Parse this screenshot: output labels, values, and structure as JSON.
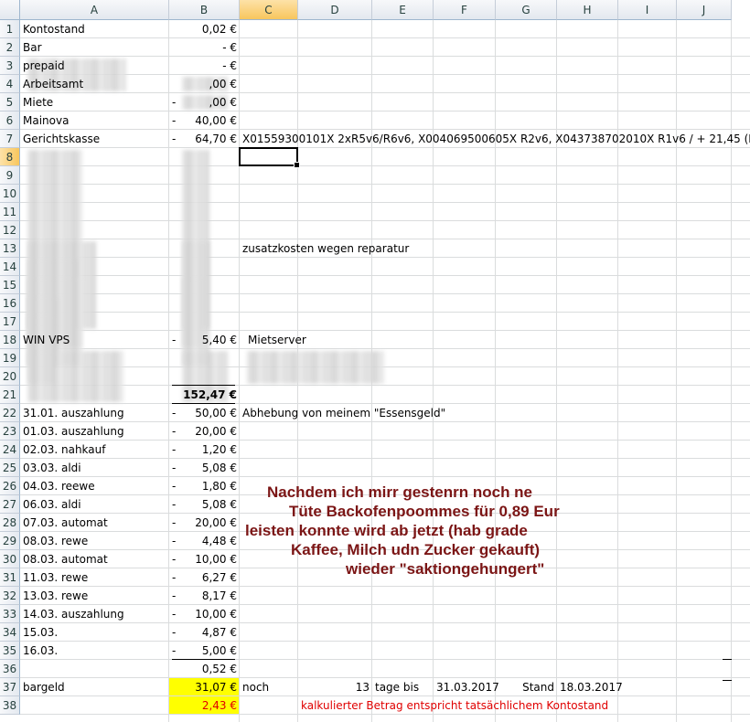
{
  "columns": [
    "A",
    "B",
    "C",
    "D",
    "E",
    "F",
    "G",
    "H",
    "I",
    "J"
  ],
  "rows": [
    {
      "n": "1",
      "a": "Kontostand",
      "b": "0,02 €",
      "c": ""
    },
    {
      "n": "2",
      "a": "Bar",
      "b": "-   €",
      "c": ""
    },
    {
      "n": "3",
      "a": "prepaid",
      "b": "-   €",
      "c": ""
    },
    {
      "n": "4",
      "a": "Arbeitsamt",
      "b": ",00 €",
      "c": ""
    },
    {
      "n": "5",
      "a": "Miete",
      "b": ",00 €",
      "c": "",
      "sign": "-"
    },
    {
      "n": "6",
      "a": "Mainova",
      "b": "40,00 €",
      "c": "",
      "sign": "-"
    },
    {
      "n": "7",
      "a": "Gerichtskasse",
      "b": "64,70 €",
      "c": "X01559300101X 2xR5v6/R6v6, X004069500605X R2v6, X043738702010X R1v6 / + 21,45 (EOS)",
      "sign": "-"
    },
    {
      "n": "8",
      "a": "",
      "b": "",
      "c": ""
    },
    {
      "n": "9",
      "a": "",
      "b": "",
      "c": ""
    },
    {
      "n": "10",
      "a": "",
      "b": "",
      "c": ""
    },
    {
      "n": "11",
      "a": "",
      "b": "",
      "c": ""
    },
    {
      "n": "12",
      "a": "",
      "b": "",
      "c": ""
    },
    {
      "n": "13",
      "a": "",
      "b": "",
      "c": "zusatzkosten wegen reparatur"
    },
    {
      "n": "14",
      "a": "",
      "b": "",
      "c": ""
    },
    {
      "n": "15",
      "a": "",
      "b": "",
      "c": ""
    },
    {
      "n": "16",
      "a": "",
      "b": "",
      "c": ""
    },
    {
      "n": "17",
      "a": "",
      "b": "",
      "c": ""
    },
    {
      "n": "18",
      "a": "WIN VPS",
      "b": "5,40 €",
      "c": "Mietserver",
      "sign": "-"
    },
    {
      "n": "19",
      "a": "",
      "b": "",
      "c": ""
    },
    {
      "n": "20",
      "a": "",
      "b": "",
      "c": ""
    },
    {
      "n": "21",
      "a": "",
      "b": "152,47 €",
      "c": ""
    },
    {
      "n": "22",
      "a": "31.01. auszahlung",
      "b": "50,00 €",
      "c": "Abhebung von meinem \"Essensgeld\"",
      "sign": "-"
    },
    {
      "n": "23",
      "a": "01.03. auszahlung",
      "b": "20,00 €",
      "c": "",
      "sign": "-"
    },
    {
      "n": "24",
      "a": "02.03. nahkauf",
      "b": "1,20 €",
      "c": "",
      "sign": "-"
    },
    {
      "n": "25",
      "a": "03.03. aldi",
      "b": "5,08 €",
      "c": "",
      "sign": "-"
    },
    {
      "n": "26",
      "a": "04.03. reewe",
      "b": "1,80 €",
      "c": "",
      "sign": "-"
    },
    {
      "n": "27",
      "a": "06.03. aldi",
      "b": "5,08 €",
      "c": "",
      "sign": "-"
    },
    {
      "n": "28",
      "a": "07.03. automat",
      "b": "20,00 €",
      "c": "",
      "sign": "-"
    },
    {
      "n": "29",
      "a": "08.03. rewe",
      "b": "4,48 €",
      "c": "",
      "sign": "-"
    },
    {
      "n": "30",
      "a": "08.03. automat",
      "b": "10,00 €",
      "c": "",
      "sign": "-"
    },
    {
      "n": "31",
      "a": "11.03. rewe",
      "b": "6,27 €",
      "c": "",
      "sign": "-"
    },
    {
      "n": "32",
      "a": "13.03. rewe",
      "b": "8,17 €",
      "c": "",
      "sign": "-"
    },
    {
      "n": "33",
      "a": "14.03. auszahlung",
      "b": "10,00 €",
      "c": "",
      "sign": "-"
    },
    {
      "n": "34",
      "a": "15.03.",
      "b": "4,87 €",
      "c": "",
      "sign": "-"
    },
    {
      "n": "35",
      "a": "16.03.",
      "b": "5,00 €",
      "c": "",
      "sign": "-"
    },
    {
      "n": "36",
      "a": "",
      "b": "0,52 €",
      "c": ""
    },
    {
      "n": "37",
      "a": "bargeld",
      "b": "31,07 €",
      "c": "noch"
    },
    {
      "n": "38",
      "a": "",
      "b": "2,43 €",
      "c": ""
    }
  ],
  "row37": {
    "d": "13",
    "e": "tage bis",
    "f": "31.03.2017",
    "g": "Stand",
    "h": "18.03.2017"
  },
  "row38_note": "kalkulierter Betrag entspricht tatsächlichem Kontostand",
  "note_lines": [
    "Nachdem ich mirr gestenrn noch ne",
    "Tüte Backofenpoommes für 0,89 Eur",
    "leisten konnte wird ab jetzt (hab grade",
    "Kaffee, Milch udn Zucker gekauft)",
    "wieder \"saktiongehungert\""
  ],
  "colors": {
    "note": "#7b1515",
    "red_text": "#e00000",
    "highlight": "#ffff00"
  }
}
